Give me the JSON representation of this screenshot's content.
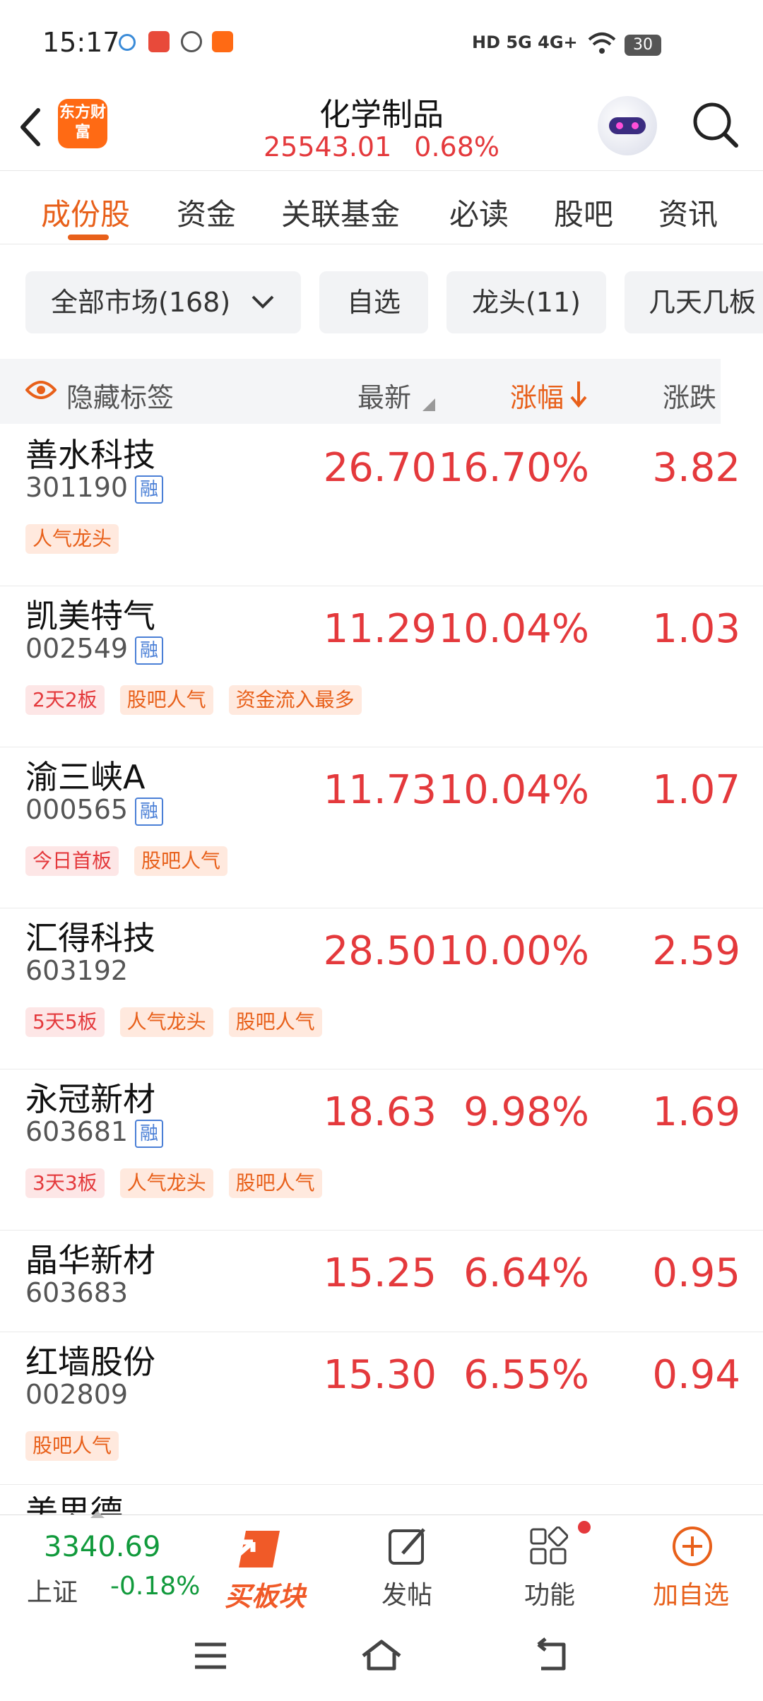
{
  "status_bar": {
    "time": "15:17",
    "net": "HD 5G 4G+",
    "battery": "30"
  },
  "header": {
    "logo_text": "东方财富",
    "title": "化学制品",
    "index_value": "25543.01",
    "index_change": "0.68%"
  },
  "tabs": [
    "成份股",
    "资金",
    "关联基金",
    "必读",
    "股吧",
    "资讯"
  ],
  "filters": [
    "全部市场(168)",
    "自选",
    "龙头(11)",
    "几天几板"
  ],
  "columns": {
    "hide_tags": "隐藏标签",
    "latest": "最新",
    "change_pct": "涨幅",
    "change": "涨跌"
  },
  "stocks": [
    {
      "name": "善水科技",
      "code": "301190",
      "rong": "融",
      "price": "26.70",
      "pct": "16.70%",
      "chg": "3.82",
      "tags": [
        {
          "t": "人气龙头",
          "c": "orange"
        }
      ]
    },
    {
      "name": "凯美特气",
      "code": "002549",
      "rong": "融",
      "price": "11.29",
      "pct": "10.04%",
      "chg": "1.03",
      "tags": [
        {
          "t": "2天2板",
          "c": "red"
        },
        {
          "t": "股吧人气",
          "c": "orange"
        },
        {
          "t": "资金流入最多",
          "c": "orange"
        }
      ]
    },
    {
      "name": "渝三峡A",
      "code": "000565",
      "rong": "融",
      "price": "11.73",
      "pct": "10.04%",
      "chg": "1.07",
      "tags": [
        {
          "t": "今日首板",
          "c": "red"
        },
        {
          "t": "股吧人气",
          "c": "orange"
        }
      ]
    },
    {
      "name": "汇得科技",
      "code": "603192",
      "rong": "",
      "price": "28.50",
      "pct": "10.00%",
      "chg": "2.59",
      "tags": [
        {
          "t": "5天5板",
          "c": "red"
        },
        {
          "t": "人气龙头",
          "c": "orange"
        },
        {
          "t": "股吧人气",
          "c": "orange"
        }
      ]
    },
    {
      "name": "永冠新材",
      "code": "603681",
      "rong": "融",
      "price": "18.63",
      "pct": "9.98%",
      "chg": "1.69",
      "tags": [
        {
          "t": "3天3板",
          "c": "red"
        },
        {
          "t": "人气龙头",
          "c": "orange"
        },
        {
          "t": "股吧人气",
          "c": "orange"
        }
      ]
    },
    {
      "name": "晶华新材",
      "code": "603683",
      "rong": "",
      "price": "15.25",
      "pct": "6.64%",
      "chg": "0.95",
      "tags": []
    },
    {
      "name": "红墙股份",
      "code": "002809",
      "rong": "",
      "price": "15.30",
      "pct": "6.55%",
      "chg": "0.94",
      "tags": [
        {
          "t": "股吧人气",
          "c": "orange"
        }
      ]
    }
  ],
  "partial_row_name": "美思德",
  "bottom_nav": {
    "index_value": "3340.69",
    "index_name": "上证",
    "index_change": "-0.18%",
    "buy_board": "买板块",
    "post": "发帖",
    "features": "功能",
    "add_watch": "加自选"
  },
  "colors": {
    "accent": "#e8601a",
    "up": "#e4393c",
    "down": "#119a3c"
  }
}
